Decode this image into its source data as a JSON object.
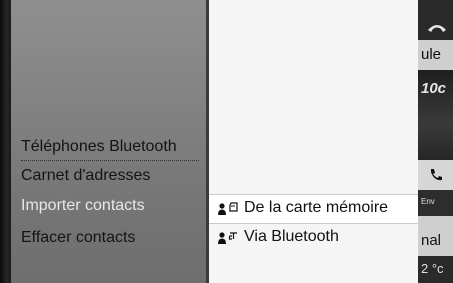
{
  "menu": {
    "items": [
      {
        "label": "Téléphones Bluetooth"
      },
      {
        "label": "Carnet d'adresses"
      },
      {
        "label": "Importer contacts"
      },
      {
        "label": "Effacer contacts"
      }
    ]
  },
  "submenu": {
    "items": [
      {
        "label": "De la carte mémoire",
        "icon": "memory-card-contact-icon"
      },
      {
        "label": "Via Bluetooth",
        "icon": "bluetooth-contact-icon"
      }
    ]
  },
  "right_strip": {
    "text_ule": "ule",
    "text_10c": "10c",
    "text_env": "Env",
    "text_nal": "nal",
    "text_temp": "2 °c"
  },
  "colors": {
    "menu_bg": "#838383",
    "selected_text": "#e8e8e8",
    "submenu_bg": "#f5f5f5"
  }
}
